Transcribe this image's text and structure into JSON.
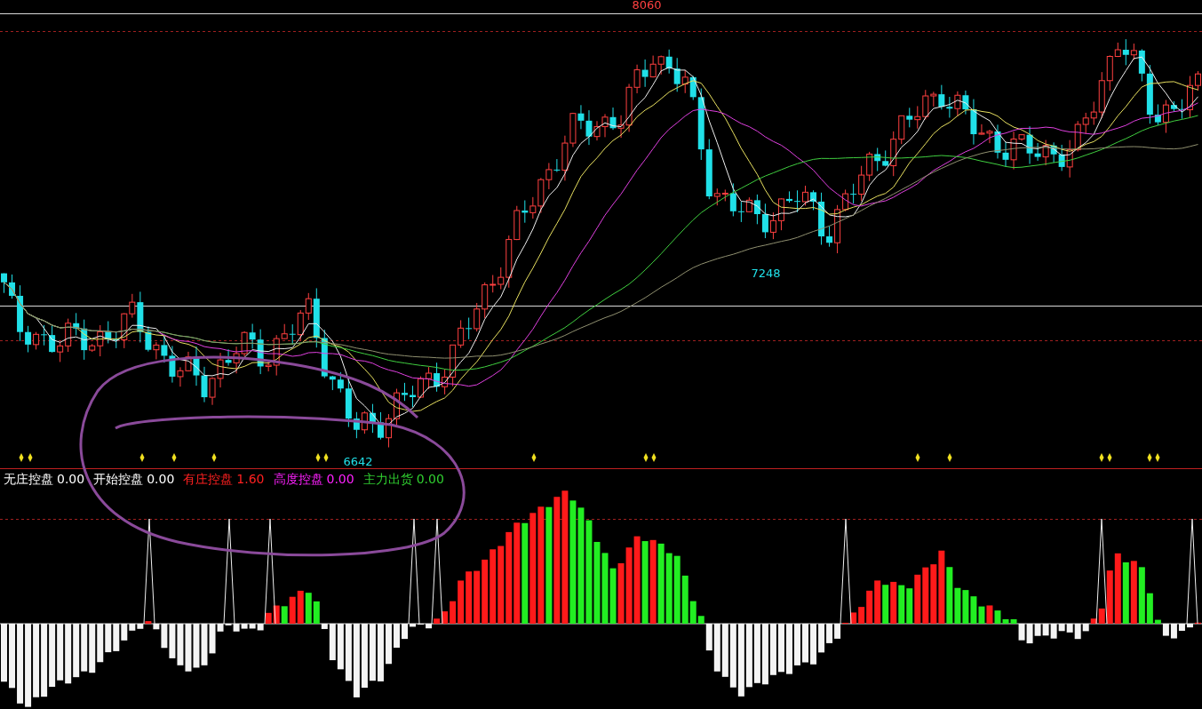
{
  "price_chart": {
    "labels": [
      {
        "text": "8060",
        "kind": "high"
      },
      {
        "text": "7248",
        "kind": "low"
      },
      {
        "text": "6642",
        "kind": "low"
      }
    ]
  },
  "indicator": {
    "legend": [
      {
        "name": "无庄控盘",
        "value": "0.00",
        "color": "#ffffff"
      },
      {
        "name": "开始控盘",
        "value": "0.00",
        "color": "#ffffff"
      },
      {
        "name": "有庄控盘",
        "value": "1.60",
        "color": "#ff2020"
      },
      {
        "name": "高度控盘",
        "value": "0.00",
        "color": "#ff20ff"
      },
      {
        "name": "主力出货",
        "value": "0.00",
        "color": "#30d030"
      }
    ]
  }
}
